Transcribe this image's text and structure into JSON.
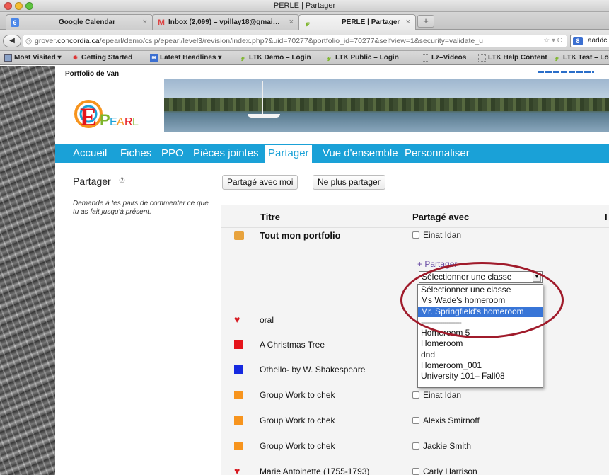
{
  "window": {
    "title": "PERLE | Partager"
  },
  "tabs": [
    {
      "label": "Google Calendar",
      "icon": "calendar-icon"
    },
    {
      "label": "Inbox (2,099) – vpillay18@gmai…",
      "icon": "gmail-icon"
    },
    {
      "label": "PERLE | Partager",
      "icon": "perle-icon",
      "active": true
    }
  ],
  "newtab_label": "+",
  "url": {
    "prefix": "grover.",
    "domain": "concordia.ca",
    "path": "/epearl/demo/cslp/epearl/level3/revision/index.php?&uid=70277&portfolio_id=70277&selfview=1&security=validate_u"
  },
  "search": {
    "engine_label": "8",
    "value": "aaddc"
  },
  "bookmarks": [
    {
      "label": "Most Visited ▾",
      "icon": "folder-icon"
    },
    {
      "label": "Getting Started",
      "icon": "firefox-icon"
    },
    {
      "label": "Latest Headlines ▾",
      "icon": "rss-icon"
    },
    {
      "label": "LTK Demo – Login",
      "icon": "ltk-icon"
    },
    {
      "label": "LTK Public – Login",
      "icon": "ltk-icon"
    },
    {
      "label": "Lz–Videos",
      "icon": "page-icon"
    },
    {
      "label": "LTK Help Content",
      "icon": "page-icon"
    },
    {
      "label": "LTK Test – Login",
      "icon": "ltk-icon"
    }
  ],
  "site": {
    "owner": "Portfolio de Van",
    "logo_text": "EPEARL",
    "nav": [
      "Accueil",
      "Fiches",
      "PPO",
      "Pièces jointes",
      "Partager",
      "Vue d'ensemble",
      "Personnaliser"
    ],
    "active_nav": "Partager"
  },
  "page": {
    "title": "Partager",
    "help_symbol": "⑦",
    "buttons": {
      "shared_with_me": "Partagé avec moi",
      "stop_sharing": "Ne plus partager"
    },
    "hint": "Demande à tes pairs de commenter ce que tu as fait jusqu'à présent.",
    "columns": {
      "title": "Titre",
      "shared_with": "Partagé avec",
      "extra": "I"
    },
    "add_share_label": "+ Partager",
    "select_value": "Sélectionner une classe",
    "options": [
      "Sélectionner une classe",
      "Ms Wade's homeroom",
      "Mr. Springfield's homeroom",
      "-------------------",
      "Homeroom 5",
      "Homeroom",
      "dnd",
      "Homeroom_001",
      "University 101– Fall08"
    ],
    "selected_option_index": 2,
    "rows": [
      {
        "title": "Tout mon portfolio",
        "icon": "portfolio-icon",
        "color": "#e8a33d",
        "share": "Einat Idan",
        "bold": true
      },
      {
        "title": "oral",
        "icon": "heart-icon",
        "color": "#d71920",
        "share": ""
      },
      {
        "title": "A Christmas Tree",
        "icon": "square-icon",
        "color": "#e5141b",
        "share": ""
      },
      {
        "title": "Othello- by W. Shakespeare",
        "icon": "square-icon",
        "color": "#1529e0",
        "share": ""
      },
      {
        "title": "Group Work to chek",
        "icon": "square-icon",
        "color": "#f7941d",
        "share": "Einat Idan"
      },
      {
        "title": "Group Work to chek",
        "icon": "square-icon",
        "color": "#f7941d",
        "share": "Alexis Smirnoff"
      },
      {
        "title": "Group Work to chek",
        "icon": "square-icon",
        "color": "#f7941d",
        "share": "Jackie Smith"
      },
      {
        "title": "Marie Antoinette (1755-1793)",
        "icon": "heart-icon",
        "color": "#d71920",
        "share": "Carly Harrison"
      }
    ]
  },
  "colors": {
    "nav_bg": "#1aa1d7",
    "highlight": "#3875d7",
    "annotation": "#a01b2b"
  }
}
